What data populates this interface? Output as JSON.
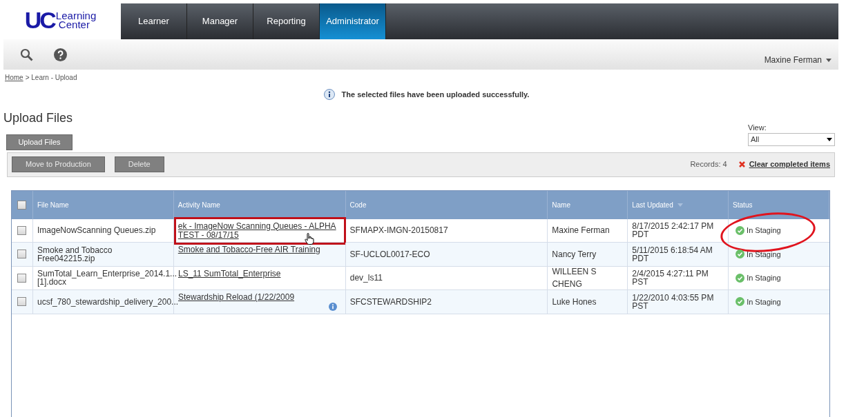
{
  "logo": {
    "initials": "UC",
    "line_1": "Learning",
    "line_2": "Center"
  },
  "nav_tabs": [
    {
      "label": "Learner",
      "selected": false
    },
    {
      "label": "Manager",
      "selected": false
    },
    {
      "label": "Reporting",
      "selected": false
    },
    {
      "label": "Administrator",
      "selected": true
    }
  ],
  "user_menu": "Maxine Ferman",
  "breadcrumb": {
    "link": "Home",
    "rest": "> Learn - Upload"
  },
  "message": "The selected files have been uploaded successfully.",
  "page_title": "Upload Files",
  "upload_button": "Upload Files",
  "view": {
    "label": "View:",
    "value": "All"
  },
  "actions": [
    "Move to Production",
    "Delete"
  ],
  "records": "Records: 4",
  "clear_link": "Clear completed items",
  "table": {
    "columns": [
      {
        "label": "File Name",
        "sorted": false
      },
      {
        "label": "Activity Name",
        "sorted": false
      },
      {
        "label": "Code",
        "sorted": false
      },
      {
        "label": "Name",
        "sorted": false
      },
      {
        "label": "Last Updated",
        "sorted": true
      },
      {
        "label": "Status",
        "sorted": false
      }
    ],
    "header_checked": false,
    "rows": [
      {
        "checked": false,
        "file": "ImageNowScanning Queues.zip",
        "activity": "ek - ImageNow Scanning Queues - ALPHA TEST - 08/17/15",
        "activity_boxed": true,
        "info": false,
        "code": "SFMAPX-IMGN-20150817",
        "name": "Maxine Ferman",
        "updated": "8/17/2015 2:42:17 PM PDT",
        "status": "In Staging",
        "status_circled": true
      },
      {
        "checked": false,
        "file": "Smoke and Tobacco Free042215.zip",
        "activity": "Smoke and Tobacco-Free AIR Training",
        "activity_boxed": false,
        "info": false,
        "code": "SF-UCLOL0017-ECO",
        "name": "Nancy Terry",
        "updated": "5/11/2015 6:18:54 AM PDT",
        "status": "In Staging",
        "status_circled": false
      },
      {
        "checked": false,
        "file": "SumTotal_Learn_Enterprise_2014.1... [1].docx",
        "activity": "LS_11 SumTotal_Enterprise",
        "activity_boxed": false,
        "info": false,
        "code": "dev_ls11",
        "name": "WILLEEN S CHENG",
        "updated": "2/4/2015 4:27:11 PM PST",
        "status": "In Staging",
        "status_circled": false
      },
      {
        "checked": false,
        "file": "ucsf_780_stewardship_delivery_200...",
        "activity": "Stewardship Reload (1/22/2009",
        "activity_boxed": false,
        "info": true,
        "code": "SFCSTEWARDSHIP2",
        "name": "Luke Hones",
        "updated": "1/22/2010 4:03:55 PM PST",
        "status": "In Staging",
        "status_circled": false
      }
    ]
  }
}
